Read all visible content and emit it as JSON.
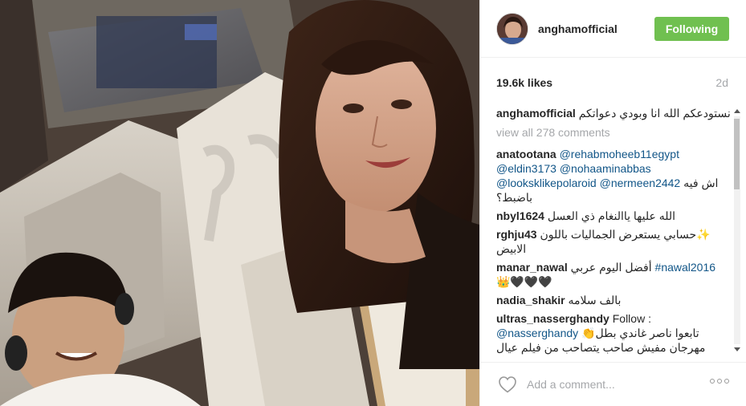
{
  "post": {
    "photo_alt": "",
    "photo_icon": "selfie-photo"
  },
  "header": {
    "username": "anghamofficial",
    "follow_label": "Following",
    "follow_color": "#70c050"
  },
  "stats": {
    "likes": "19.6k likes",
    "age": "2d"
  },
  "caption": {
    "user": "anghamofficial",
    "text": "نستودعكم الله انا وبودي دعواتكم"
  },
  "view_all": "view all 278 comments",
  "comments": [
    {
      "user": "anatootana",
      "parts": [
        "@rehabmoheeb11egypt",
        "@eldin3173",
        "@nohaaminabbas",
        "@looksklikepolaroid",
        "@nermeen2442"
      ],
      "text": "اش فيه باضبط؟"
    },
    {
      "user": "nbyl1624",
      "text": "الله عليها ياالنغام ذي العسل"
    },
    {
      "user": "rghju43",
      "text": "✨حسابي يستعرض الجماليات باللون الابيض"
    },
    {
      "user": "manar_nawal",
      "text": "أفضل اليوم عربي",
      "tag": "#nawal2016",
      "trail": "👑🖤🖤🖤"
    },
    {
      "user": "nadia_shakir",
      "text": "بالف سلامه"
    },
    {
      "user": "ultras_nasserghandy",
      "lead": "Follow :",
      "mention": "@nasserghandy",
      "text": "تابعوا ناصر غاندي بطل👏",
      "text2": "مهرجان مفيش صاحب يتصاحب من فيلم عيال حريفه من انتاج السبكي 😉"
    }
  ],
  "footer": {
    "placeholder": "Add a comment...",
    "like_icon": "heart-icon",
    "more_icon": "more-options-icon"
  }
}
